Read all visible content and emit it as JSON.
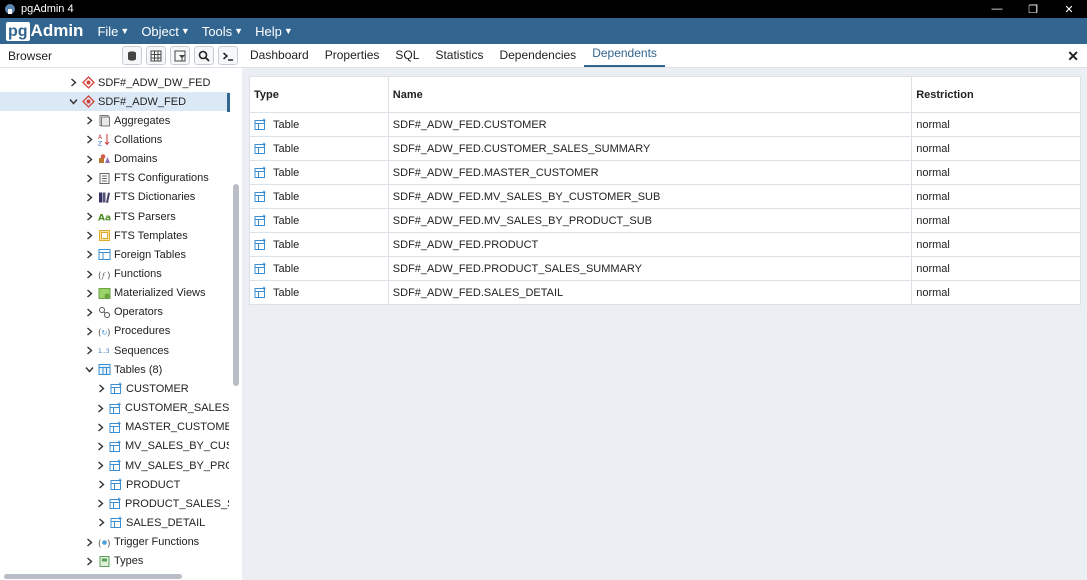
{
  "window": {
    "title": "pgAdmin 4",
    "minimize": "—",
    "restore": "❐",
    "close": "✕"
  },
  "menu": {
    "logo_pg": "pg",
    "logo_admin": "Admin",
    "items": [
      "File",
      "Object",
      "Tools",
      "Help"
    ]
  },
  "browser": {
    "label": "Browser"
  },
  "tabs": [
    "Dashboard",
    "Properties",
    "SQL",
    "Statistics",
    "Dependencies",
    "Dependents"
  ],
  "active_tab": "Dependents",
  "tree": [
    {
      "label": "SDF#_ADW_DW_FED",
      "indent": 0,
      "icon": "database-icon",
      "expanded": false
    },
    {
      "label": "SDF#_ADW_FED",
      "indent": 0,
      "icon": "database-icon",
      "expanded": true,
      "selected": true
    },
    {
      "label": "Aggregates",
      "indent": 1,
      "icon": "aggregates-icon",
      "expanded": false
    },
    {
      "label": "Collations",
      "indent": 1,
      "icon": "collations-icon",
      "expanded": false
    },
    {
      "label": "Domains",
      "indent": 1,
      "icon": "domains-icon",
      "expanded": false
    },
    {
      "label": "FTS Configurations",
      "indent": 1,
      "icon": "fts-configurations-icon",
      "expanded": false
    },
    {
      "label": "FTS Dictionaries",
      "indent": 1,
      "icon": "fts-dictionaries-icon",
      "expanded": false
    },
    {
      "label": "FTS Parsers",
      "indent": 1,
      "icon": "fts-parsers-icon",
      "expanded": false
    },
    {
      "label": "FTS Templates",
      "indent": 1,
      "icon": "fts-templates-icon",
      "expanded": false
    },
    {
      "label": "Foreign Tables",
      "indent": 1,
      "icon": "foreign-tables-icon",
      "expanded": false
    },
    {
      "label": "Functions",
      "indent": 1,
      "icon": "functions-icon",
      "expanded": false
    },
    {
      "label": "Materialized Views",
      "indent": 1,
      "icon": "materialized-views-icon",
      "expanded": false
    },
    {
      "label": "Operators",
      "indent": 1,
      "icon": "operators-icon",
      "expanded": false
    },
    {
      "label": "Procedures",
      "indent": 1,
      "icon": "procedures-icon",
      "expanded": false
    },
    {
      "label": "Sequences",
      "indent": 1,
      "icon": "sequences-icon",
      "expanded": false
    },
    {
      "label": "Tables (8)",
      "indent": 1,
      "icon": "tables-icon",
      "expanded": true
    },
    {
      "label": "CUSTOMER",
      "indent": 2,
      "icon": "table-icon",
      "expanded": false
    },
    {
      "label": "CUSTOMER_SALES_SU",
      "indent": 2,
      "icon": "table-icon",
      "expanded": false
    },
    {
      "label": "MASTER_CUSTOMER",
      "indent": 2,
      "icon": "table-icon",
      "expanded": false
    },
    {
      "label": "MV_SALES_BY_CUSTO",
      "indent": 2,
      "icon": "table-icon",
      "expanded": false
    },
    {
      "label": "MV_SALES_BY_PRODU",
      "indent": 2,
      "icon": "table-icon",
      "expanded": false
    },
    {
      "label": "PRODUCT",
      "indent": 2,
      "icon": "table-icon",
      "expanded": false
    },
    {
      "label": "PRODUCT_SALES_SUM",
      "indent": 2,
      "icon": "table-icon",
      "expanded": false
    },
    {
      "label": "SALES_DETAIL",
      "indent": 2,
      "icon": "table-icon",
      "expanded": false
    },
    {
      "label": "Trigger Functions",
      "indent": 1,
      "icon": "trigger-functions-icon",
      "expanded": false
    },
    {
      "label": "Types",
      "indent": 1,
      "icon": "types-icon",
      "expanded": false
    }
  ],
  "grid": {
    "headers": {
      "type": "Type",
      "name": "Name",
      "restriction": "Restriction"
    },
    "rows": [
      {
        "type": "Table",
        "name": "SDF#_ADW_FED.CUSTOMER",
        "restriction": "normal"
      },
      {
        "type": "Table",
        "name": "SDF#_ADW_FED.CUSTOMER_SALES_SUMMARY",
        "restriction": "normal"
      },
      {
        "type": "Table",
        "name": "SDF#_ADW_FED.MASTER_CUSTOMER",
        "restriction": "normal"
      },
      {
        "type": "Table",
        "name": "SDF#_ADW_FED.MV_SALES_BY_CUSTOMER_SUB",
        "restriction": "normal"
      },
      {
        "type": "Table",
        "name": "SDF#_ADW_FED.MV_SALES_BY_PRODUCT_SUB",
        "restriction": "normal"
      },
      {
        "type": "Table",
        "name": "SDF#_ADW_FED.PRODUCT",
        "restriction": "normal"
      },
      {
        "type": "Table",
        "name": "SDF#_ADW_FED.PRODUCT_SALES_SUMMARY",
        "restriction": "normal"
      },
      {
        "type": "Table",
        "name": "SDF#_ADW_FED.SALES_DETAIL",
        "restriction": "normal"
      }
    ]
  },
  "colors": {
    "brand": "#326690",
    "selected_row": "#dbe9f6"
  }
}
